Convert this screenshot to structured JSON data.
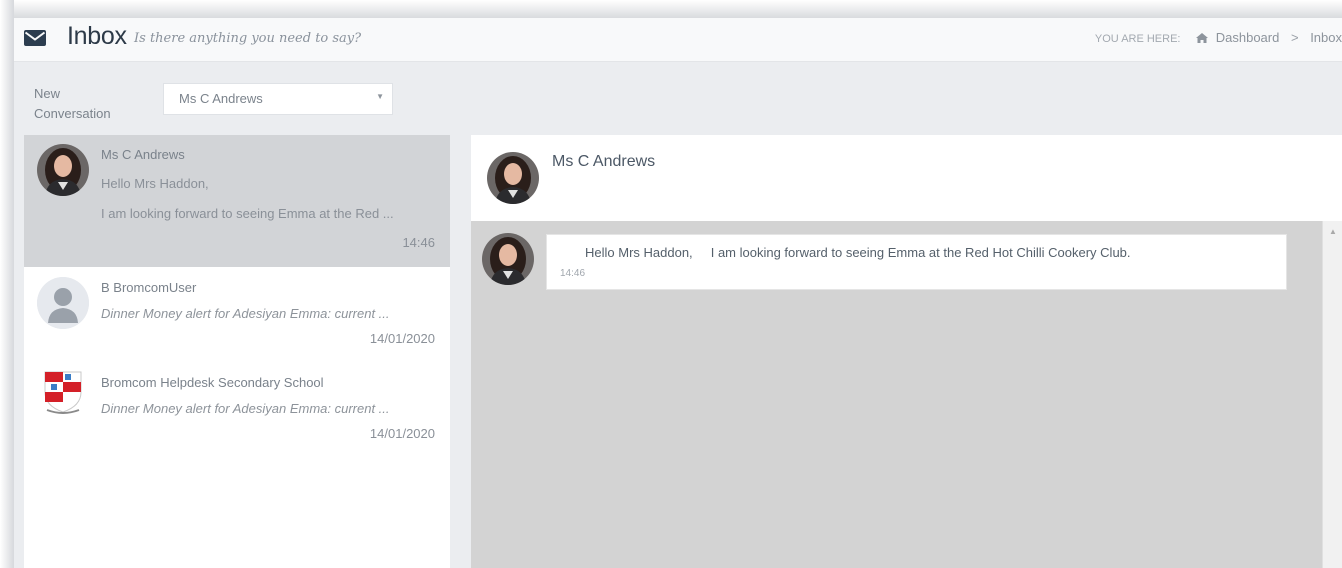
{
  "header": {
    "title": "Inbox",
    "subtitle": "Is there anything you need to say?",
    "icon": "envelope-icon",
    "breadcrumb": {
      "label": "YOU ARE HERE:",
      "home_icon": "home-icon",
      "items": [
        "Dashboard",
        "Inbox"
      ],
      "separator": ">"
    }
  },
  "new_conversation": {
    "label": "New Conversation",
    "selected": "Ms C Andrews",
    "caret": "▼"
  },
  "conversations": [
    {
      "name": "Ms C Andrews",
      "line1": "Hello Mrs Haddon,",
      "line2": "I am looking forward to seeing Emma at the Red ...",
      "time": "14:46",
      "avatar": "woman-photo-avatar",
      "active": true
    },
    {
      "name": "B BromcomUser",
      "line1": "Dinner Money alert for Adesiyan Emma: current ...",
      "time": "14/01/2020",
      "avatar": "default-user-avatar",
      "active": false
    },
    {
      "name": "Bromcom Helpdesk Secondary School",
      "line1": "Dinner Money alert for Adesiyan Emma: current ...",
      "time": "14/01/2020",
      "avatar": "school-crest-avatar",
      "active": false
    }
  ],
  "chat": {
    "name": "Ms C Andrews",
    "messages": [
      {
        "text": "Hello Mrs Haddon,     I am looking forward to seeing Emma at the Red Hot Chilli Cookery Club.",
        "time": "14:46"
      }
    ],
    "scroll_up": "▲"
  },
  "colors": {
    "active_item": "#d2d4d7",
    "chat_background": "#d3d3d3",
    "title": "#2d3a48"
  }
}
